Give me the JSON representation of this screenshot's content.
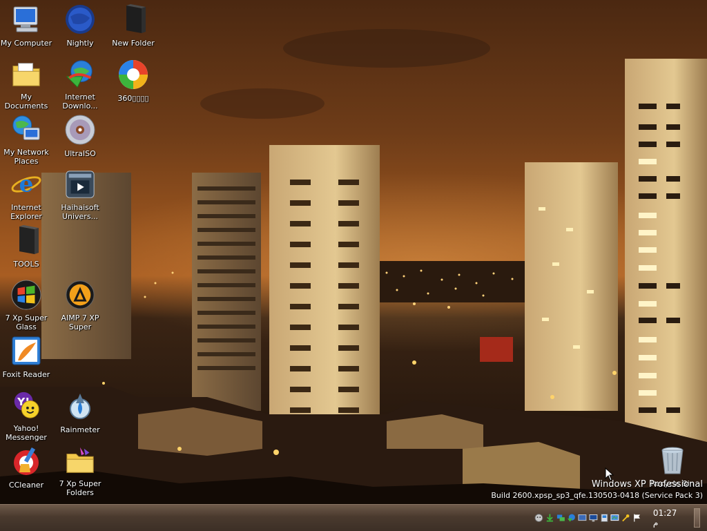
{
  "desktop": {
    "icons": [
      {
        "label": "My Computer",
        "icon": "my-computer-icon"
      },
      {
        "label": "Nightly",
        "icon": "nightly-browser-icon"
      },
      {
        "label": "New Folder",
        "icon": "new-folder-icon"
      },
      {
        "label": "My Documents",
        "icon": "my-documents-icon"
      },
      {
        "label": "Internet Downlo...",
        "icon": "internet-download-manager-icon"
      },
      {
        "label": "360▯▯▯▯",
        "icon": "360-icon"
      },
      {
        "label": "My Network Places",
        "icon": "network-places-icon"
      },
      {
        "label": "UltraISO",
        "icon": "ultraiso-icon"
      },
      {
        "label": "Internet Explorer",
        "icon": "internet-explorer-icon"
      },
      {
        "label": "Haihaisoft Univers...",
        "icon": "haihaisoft-player-icon"
      },
      {
        "label": "TOOLS",
        "icon": "tools-folder-icon"
      },
      {
        "label": "7 Xp Super Glass",
        "icon": "xp-super-glass-icon"
      },
      {
        "label": "AIMP 7 XP Super",
        "icon": "aimp-icon"
      },
      {
        "label": "Foxit Reader",
        "icon": "foxit-reader-icon"
      },
      {
        "label": "Yahoo! Messenger",
        "icon": "yahoo-messenger-icon"
      },
      {
        "label": "Rainmeter",
        "icon": "rainmeter-icon"
      },
      {
        "label": "CCleaner",
        "icon": "ccleaner-icon"
      },
      {
        "label": "7 Xp Super Folders",
        "icon": "xp-super-folders-icon"
      },
      {
        "label": "Recycle Bin",
        "icon": "recycle-bin-icon"
      }
    ]
  },
  "watermark": {
    "title": "Windows XP Professional",
    "build": "Build 2600.xpsp_sp3_qfe.130503-0418 (Service Pack 3)"
  },
  "taskbar": {
    "clock": "01:27 م",
    "tray_icons": [
      "messenger-tray-icon",
      "download-tray-icon",
      "network-tray-icon",
      "idm-tray-icon",
      "display-tray-icon",
      "monitor-tray-icon",
      "app-tray-icon",
      "screen-tray-icon",
      "tool-tray-icon",
      "flag-tray-icon"
    ]
  },
  "colors": {
    "sky_top": "#4e2a12",
    "sky_horizon": "#b9621e",
    "taskbar": "#4a3a2e"
  }
}
